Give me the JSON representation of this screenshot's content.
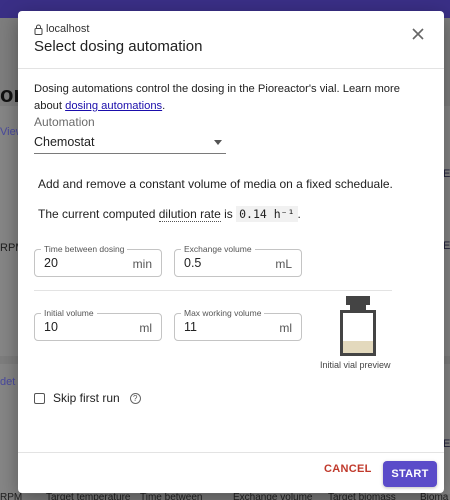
{
  "background": {
    "heading_fragment": "ors",
    "link_fragment": "View",
    "rpm_fragment": "RPM",
    "details_fragment": "det",
    "right_fragment_1": "E",
    "right_fragment_2": "E",
    "right_fragment_3": "E",
    "footer_columns": [
      "RPM",
      "Target temperature",
      "Time between",
      "Exchange volume",
      "Target biomass",
      "Bioma"
    ]
  },
  "dialog": {
    "host": "localhost",
    "title": "Select dosing automation",
    "intro_text": "Dosing automations control the dosing in the Pioreactor's vial. Learn more about ",
    "intro_link": "dosing automations",
    "intro_end": ".",
    "automation_label": "Automation",
    "automation_value": "Chemostat",
    "description": "Add and remove a constant volume of media on a fixed scheduale.",
    "rate_prefix": "The current computed ",
    "rate_term": "dilution rate",
    "rate_is": " is ",
    "rate_value": "0.14 h⁻¹",
    "rate_end": ".",
    "fields": {
      "time_between_dosing": {
        "label": "Time between dosing",
        "value": "20",
        "unit": "min"
      },
      "exchange_volume": {
        "label": "Exchange volume",
        "value": "0.5",
        "unit": "mL"
      },
      "initial_volume": {
        "label": "Initial volume",
        "value": "10",
        "unit": "ml"
      },
      "max_working_volume": {
        "label": "Max working volume",
        "value": "11",
        "unit": "ml"
      }
    },
    "vial_caption": "Initial vial preview",
    "vial_fill_fraction": 0.3,
    "skip_label": "Skip first run",
    "help_glyph": "?",
    "cancel_label": "CANCEL",
    "start_label": "START"
  },
  "colors": {
    "accent": "#5a4bc9",
    "cancel": "#c0392b",
    "topbar": "#3a2f86",
    "link": "#1a0dab"
  },
  "icons": {
    "host": "lock-icon",
    "close": "close-icon",
    "dropdown": "chevron-down-icon",
    "help": "help-circle-icon",
    "vial": "vial-icon"
  }
}
